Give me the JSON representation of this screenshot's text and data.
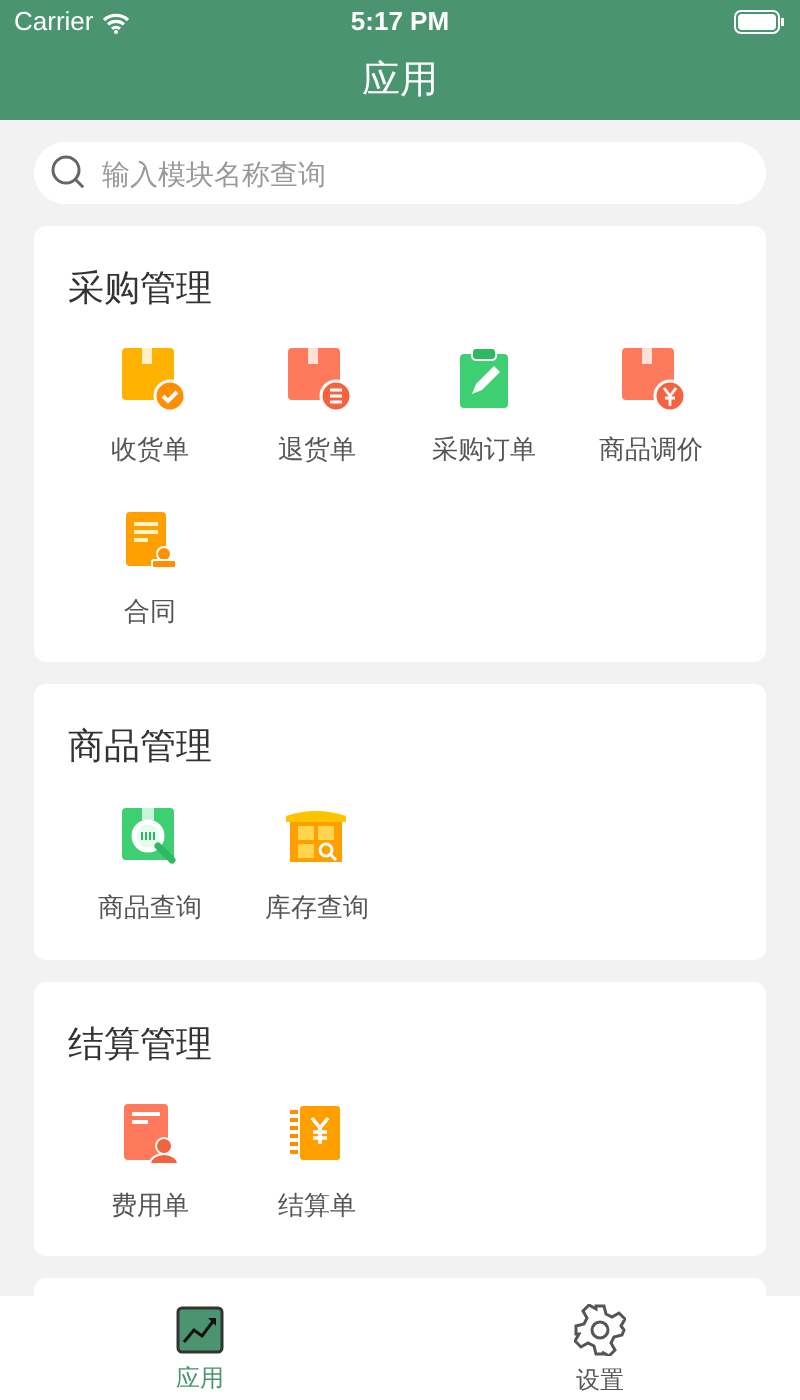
{
  "status_bar": {
    "carrier": "Carrier",
    "time": "5:17 PM"
  },
  "header": {
    "title": "应用"
  },
  "search": {
    "placeholder": "输入模块名称查询"
  },
  "sections": [
    {
      "title": "采购管理",
      "items": [
        {
          "label": "收货单",
          "kind": "box-check"
        },
        {
          "label": "退货单",
          "kind": "box-return"
        },
        {
          "label": "采购订单",
          "kind": "clipboard"
        },
        {
          "label": "商品调价",
          "kind": "box-price"
        },
        {
          "label": "合同",
          "kind": "contract"
        }
      ]
    },
    {
      "title": "商品管理",
      "items": [
        {
          "label": "商品查询",
          "kind": "product-search"
        },
        {
          "label": "库存查询",
          "kind": "warehouse"
        }
      ]
    },
    {
      "title": "结算管理",
      "items": [
        {
          "label": "费用单",
          "kind": "expense"
        },
        {
          "label": "结算单",
          "kind": "ledger"
        }
      ]
    }
  ],
  "tab_bar": [
    {
      "label": "应用",
      "kind": "apps",
      "selected": true
    },
    {
      "label": "设置",
      "kind": "settings",
      "selected": false
    }
  ]
}
